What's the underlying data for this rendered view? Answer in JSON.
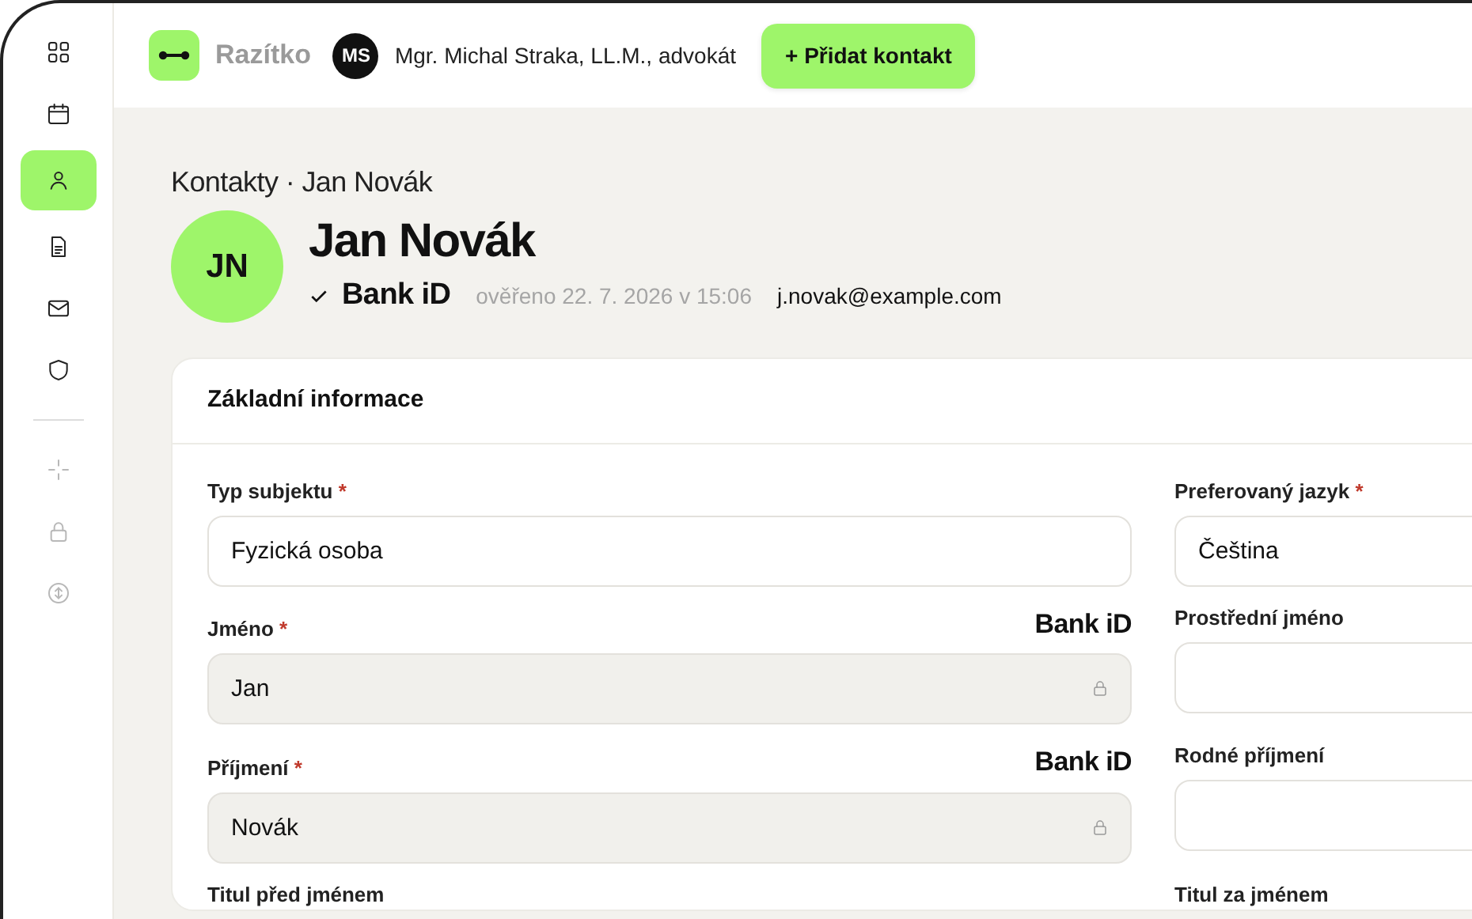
{
  "sidebar": {
    "items": [
      {
        "kind": "item",
        "selected": false,
        "disabled": false
      },
      {
        "kind": "item",
        "selected": false,
        "disabled": false
      },
      {
        "kind": "item",
        "selected": true,
        "disabled": false
      },
      {
        "kind": "item",
        "selected": false,
        "disabled": false
      },
      {
        "kind": "item",
        "selected": false,
        "disabled": false
      },
      {
        "kind": "item",
        "selected": false,
        "disabled": false
      },
      {
        "kind": "divider"
      },
      {
        "kind": "item",
        "selected": false,
        "disabled": true
      },
      {
        "kind": "item",
        "selected": false,
        "disabled": true
      },
      {
        "kind": "item",
        "selected": false,
        "disabled": true
      }
    ]
  },
  "topbar": {
    "app_name": "Razítko",
    "user_initials": "MS",
    "user_name": "Mgr. Michal Straka, LL.M., advokát",
    "add_button": "+ Přidat kontakt"
  },
  "breadcrumb": "Kontakty · Jan Novák",
  "contact": {
    "initials": "JN",
    "name": "Jan Novák",
    "verified_by": "Bank iD",
    "verified_text": "ověřeno 22. 7. 2026 v 15:06",
    "email": "j.novak@example.com"
  },
  "card": {
    "title": "Základní informace",
    "rows": [
      {
        "left": {
          "label": "Typ subjektu",
          "required_mark": "*",
          "value": "Fyzická osoba",
          "locked": false
        },
        "right": {
          "label": "Preferovaný jazyk",
          "required_mark": "*",
          "value": "Čeština",
          "locked": false
        }
      },
      {
        "left": {
          "label": "Jméno",
          "required_mark": "*",
          "badge": "Bank iD",
          "value": "Jan",
          "locked": true
        },
        "right": {
          "label": "Prostřední jméno",
          "locked": false
        }
      },
      {
        "left": {
          "label": "Příjmení",
          "required_mark": "*",
          "badge": "Bank iD",
          "value": "Novák",
          "locked": true
        },
        "right": {
          "label": "Rodné příjmení",
          "locked": false
        }
      },
      {
        "left": {
          "label": "Titul před jménem"
        },
        "right": {
          "label": "Titul za jménem"
        }
      }
    ]
  }
}
